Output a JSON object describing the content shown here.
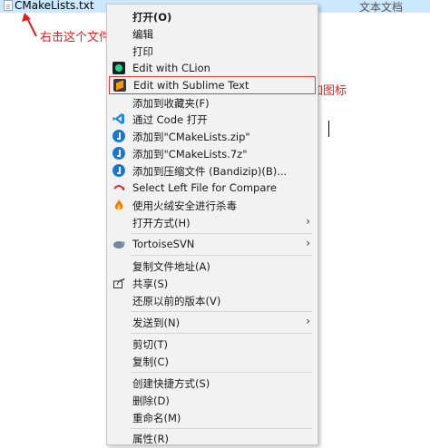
{
  "explorer": {
    "file_name": "CMakeLists.txt",
    "file_type": "文本文档"
  },
  "annotations": {
    "right_click_note": "右击这个文件",
    "added_icon_note": "刚才添加图标"
  },
  "menu": {
    "items": [
      {
        "label": "打开(O)",
        "icon": "",
        "submenu": false
      },
      {
        "label": "编辑",
        "icon": "",
        "submenu": false
      },
      {
        "label": "打印",
        "icon": "",
        "submenu": false
      },
      {
        "label": "Edit with CLion",
        "icon": "clion-icon",
        "submenu": false
      },
      {
        "label": "Edit with Sublime Text",
        "icon": "sublime-text-icon",
        "submenu": false,
        "highlighted": true
      },
      {
        "label": "添加到收藏夹(F)",
        "icon": "",
        "submenu": false
      },
      {
        "label": "通过 Code 打开",
        "icon": "vscode-icon",
        "submenu": false
      },
      {
        "label": "添加到\"CMakeLists.zip\"",
        "icon": "bandizip-icon",
        "submenu": false
      },
      {
        "label": "添加到\"CMakeLists.7z\"",
        "icon": "bandizip-icon",
        "submenu": false
      },
      {
        "label": "添加到压缩文件 (Bandizip)(B)...",
        "icon": "bandizip-icon",
        "submenu": false
      },
      {
        "label": "Select Left File for Compare",
        "icon": "compare-icon",
        "submenu": false
      },
      {
        "label": "使用火绒安全进行杀毒",
        "icon": "huorong-icon",
        "submenu": false
      },
      {
        "label": "打开方式(H)",
        "icon": "",
        "submenu": true
      },
      {
        "label": "TortoiseSVN",
        "icon": "tortoisesvn-icon",
        "submenu": true
      },
      {
        "label": "复制文件地址(A)",
        "icon": "",
        "submenu": false
      },
      {
        "label": "共享(S)",
        "icon": "share-icon",
        "submenu": false
      },
      {
        "label": "还原以前的版本(V)",
        "icon": "",
        "submenu": false
      },
      {
        "label": "发送到(N)",
        "icon": "",
        "submenu": true
      },
      {
        "label": "剪切(T)",
        "icon": "",
        "submenu": false
      },
      {
        "label": "复制(C)",
        "icon": "",
        "submenu": false
      },
      {
        "label": "创建快捷方式(S)",
        "icon": "",
        "submenu": false
      },
      {
        "label": "删除(D)",
        "icon": "",
        "submenu": false
      },
      {
        "label": "重命名(M)",
        "icon": "",
        "submenu": false
      },
      {
        "label": "属性(R)",
        "icon": "",
        "submenu": false
      }
    ],
    "submenu_glyph": "›"
  },
  "colors": {
    "annotation": "#e02020",
    "selection_bar": "#cce8ff",
    "menu_bg": "#f2f2f2"
  }
}
